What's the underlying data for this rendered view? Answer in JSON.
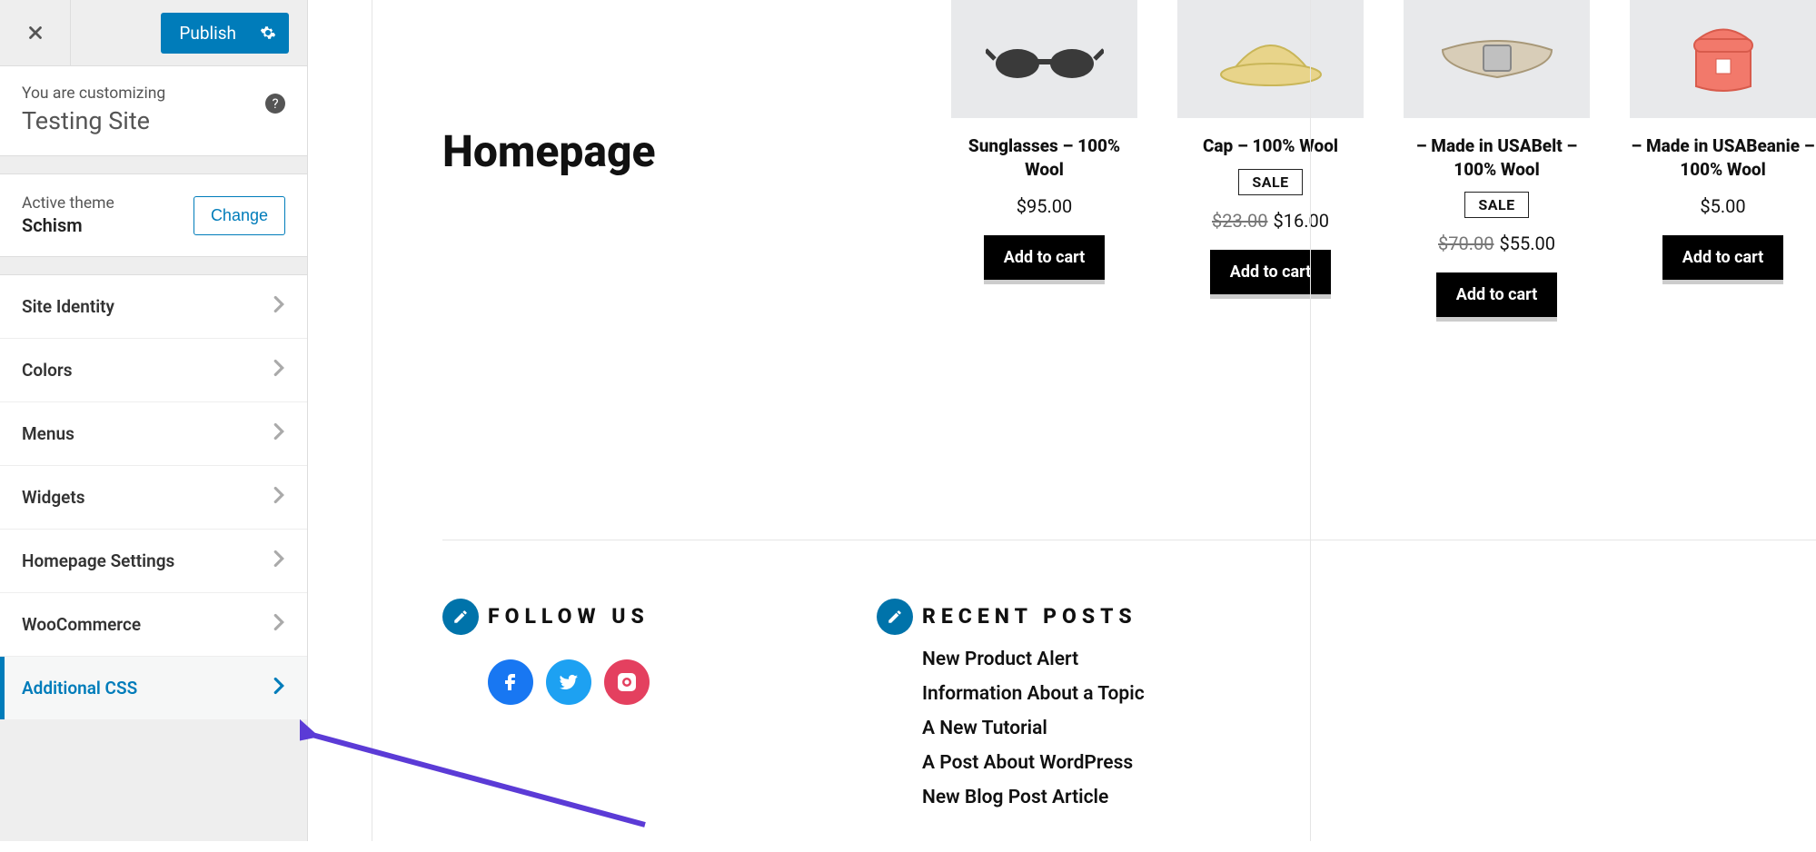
{
  "sidebar": {
    "publish_label": "Publish",
    "you_are": "You are customizing",
    "site_name": "Testing Site",
    "active_theme_label": "Active theme",
    "theme_name": "Schism",
    "change_label": "Change",
    "items": [
      {
        "label": "Site Identity"
      },
      {
        "label": "Colors"
      },
      {
        "label": "Menus"
      },
      {
        "label": "Widgets"
      },
      {
        "label": "Homepage Settings"
      },
      {
        "label": "WooCommerce"
      },
      {
        "label": "Additional CSS",
        "active": true
      }
    ]
  },
  "preview": {
    "page_title": "Homepage",
    "addcart_label": "Add to cart",
    "sale_label": "SALE",
    "products": [
      {
        "name": "Sunglasses – 100% Wool",
        "price": "$95.00"
      },
      {
        "name": "Cap – 100% Wool",
        "sale": true,
        "old_price": "$23.00",
        "price": "$16.00"
      },
      {
        "name": "– Made in USABelt – 100% Wool",
        "sale": true,
        "old_price": "$70.00",
        "price": "$55.00"
      },
      {
        "name": "– Made in USABeanie – 100% Wool",
        "price": "$5.00"
      }
    ],
    "follow_heading": "FOLLOW US",
    "recent_heading": "RECENT POSTS",
    "recent_posts": [
      "New Product Alert",
      "Information About a Topic",
      "A New Tutorial",
      "A Post About WordPress",
      "New Blog Post Article"
    ]
  }
}
